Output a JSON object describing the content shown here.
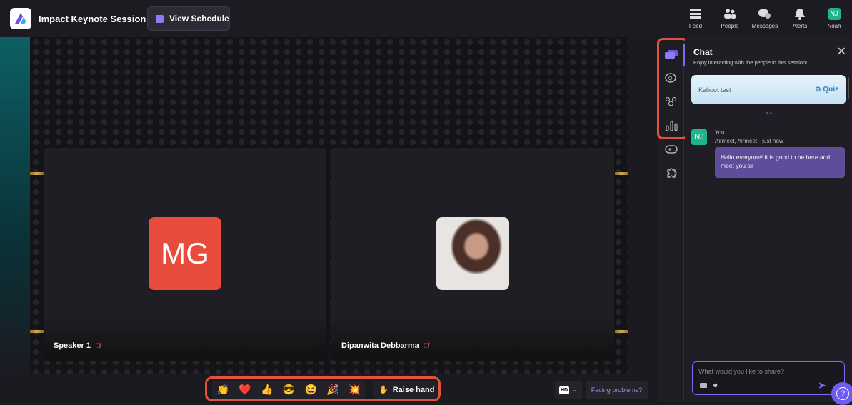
{
  "header": {
    "title": "Impact Keynote Session",
    "schedule_label": "View Schedule",
    "nav": [
      {
        "label": "Feed",
        "icon": "feed-icon"
      },
      {
        "label": "People",
        "icon": "people-icon"
      },
      {
        "label": "Messages",
        "icon": "messages-icon"
      },
      {
        "label": "Alerts",
        "icon": "bell-icon"
      },
      {
        "label": "Noah",
        "icon": "avatar",
        "initials": "NJ"
      }
    ]
  },
  "stage": {
    "tiles": [
      {
        "name": "Speaker 1",
        "initials": "MG",
        "muted": true
      },
      {
        "name": "Dipanwita Debbarma",
        "muted": true
      }
    ]
  },
  "controls": {
    "reactions": [
      "👏",
      "❤️",
      "👍",
      "😎",
      "😆",
      "🎉",
      "💥"
    ],
    "raise_hand": "Raise hand",
    "quality": "HD",
    "facing_problems": "Facing problems?"
  },
  "chat": {
    "title": "Chat",
    "subtitle": "Enjoy interacting with the people in this session!",
    "quiz_card": {
      "name": "Kahoot test",
      "label": "Quiz"
    },
    "messages": [
      {
        "initials": "NJ",
        "sender": "You",
        "meta": "Airmeet, Airmeet",
        "time": "· just now",
        "text": "Hello everyone! It is good to be here and meet you all"
      }
    ],
    "input_placeholder": "What would you like to share?"
  },
  "colors": {
    "accent": "#7b6cf0",
    "highlight": "#e1523d",
    "avatar": "#1fb38e",
    "speaker_tile": "#e84c3d"
  }
}
